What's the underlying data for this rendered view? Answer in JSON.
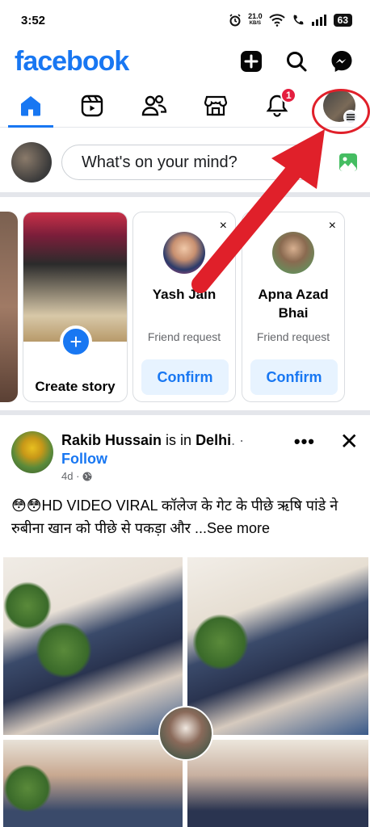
{
  "status_bar": {
    "time": "3:52",
    "net_speed_value": "21.0",
    "net_speed_unit": "KB/S",
    "battery": "63"
  },
  "header": {
    "logo": "facebook",
    "icons": [
      "plus-icon",
      "search-icon",
      "messenger-icon"
    ]
  },
  "tabs": [
    {
      "name": "home",
      "icon": "home-icon",
      "active": true
    },
    {
      "name": "reels",
      "icon": "video-icon"
    },
    {
      "name": "friends",
      "icon": "friends-icon"
    },
    {
      "name": "marketplace",
      "icon": "store-icon"
    },
    {
      "name": "notifications",
      "icon": "bell-icon",
      "badge": "1"
    },
    {
      "name": "profile-menu",
      "icon": "profile-avatar"
    }
  ],
  "composer": {
    "placeholder": "What's on your mind?"
  },
  "stories": {
    "create_label": "Create story",
    "friend_requests": [
      {
        "name": "Yash Jain",
        "subtitle": "Friend request",
        "button": "Confirm",
        "close": "×"
      },
      {
        "name": "Apna Azad Bhai",
        "subtitle": "Friend request",
        "button": "Confirm",
        "close": "×"
      }
    ]
  },
  "post": {
    "author": "Rakib Hussain",
    "connector": " is in ",
    "place": "Delhi",
    "suffix": ". ·",
    "follow": "Follow",
    "time": "4d ·",
    "more": "•••",
    "close": "✕",
    "text": "😳😳HD VIDEO VIRAL कॉलेज के गेट के पीछे ऋषि पांडे ने रुबीना खान को पीछे से पकड़ा और ...",
    "see_more": "See more"
  },
  "colors": {
    "brand": "#1877f2",
    "annotation": "#e0202a",
    "badge": "#e41e3f"
  }
}
